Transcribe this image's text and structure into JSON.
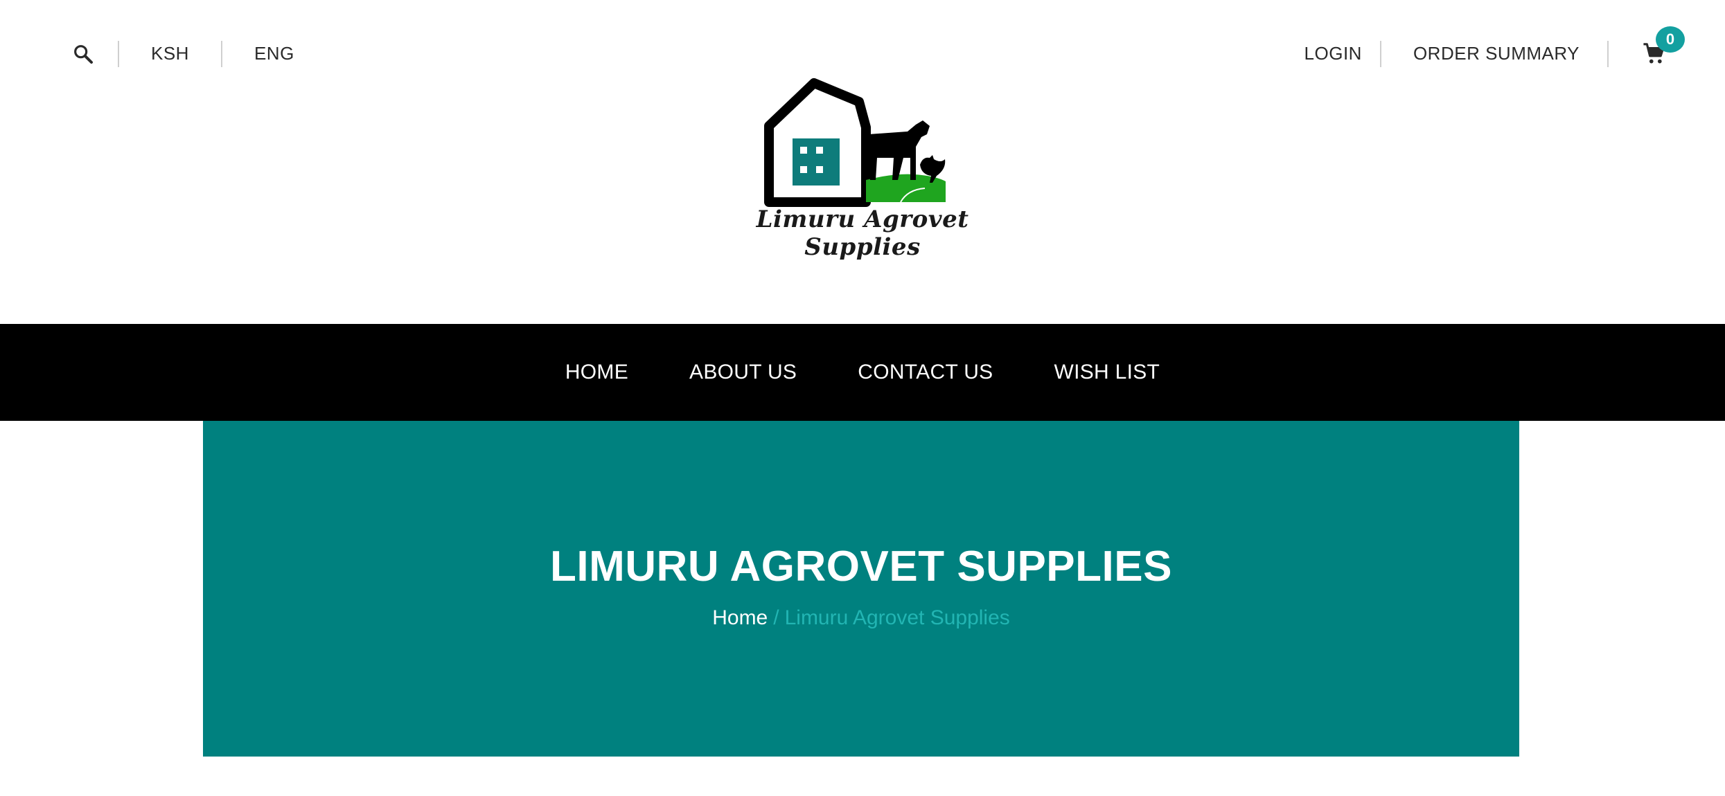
{
  "header": {
    "currency": "KSH",
    "language": "ENG",
    "login_label": "LOGIN",
    "order_summary_label": "ORDER SUMMARY",
    "cart_count": "0",
    "icons": {
      "search": "search-icon",
      "cart": "cart-icon"
    }
  },
  "logo": {
    "text": "Limuru Agrovet Supplies",
    "colors": {
      "barn": "#000000",
      "window": "#0e7c7b",
      "grass": "#1fa51f"
    }
  },
  "nav": {
    "items": [
      {
        "label": "HOME"
      },
      {
        "label": "ABOUT US"
      },
      {
        "label": "CONTACT US"
      },
      {
        "label": "WISH LIST"
      }
    ]
  },
  "hero": {
    "title": "LIMURU AGROVET SUPPLIES",
    "breadcrumb": {
      "home": "Home",
      "separator": "/",
      "current": "Limuru Agrovet Supplies"
    }
  },
  "colors": {
    "accent": "#00817f",
    "badge": "#13a0a0",
    "nav_bg": "#000000",
    "breadcrumb_current": "#22b5b3"
  }
}
